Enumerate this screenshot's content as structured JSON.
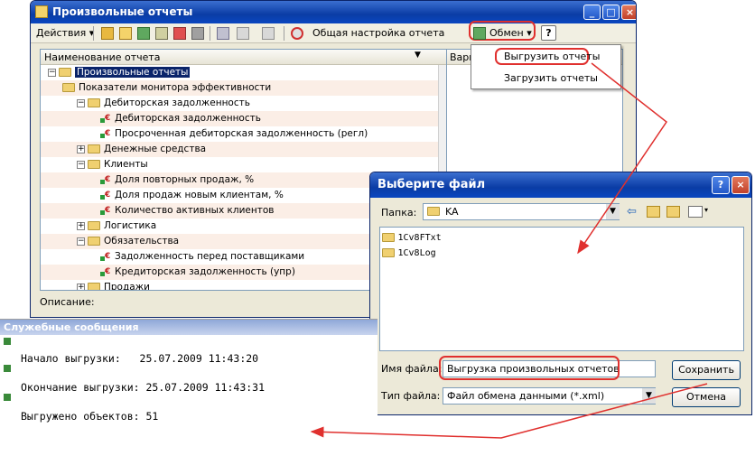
{
  "main_window": {
    "title": "Произвольные отчеты",
    "toolbar": {
      "actions": "Действия",
      "general_settings": "Общая настройка отчета",
      "exchange": "Обмен",
      "help": "?"
    },
    "tree": {
      "header": "Наименование отчета",
      "right_header": "Вари",
      "items": [
        {
          "label": "Произвольные отчеты",
          "type": "folder",
          "level": 0,
          "expanded": true
        },
        {
          "label": "Показатели монитора эффективности",
          "type": "folder",
          "level": 1
        },
        {
          "label": "Дебиторская задолженность",
          "type": "folder",
          "level": 2,
          "expanded": true
        },
        {
          "label": "Дебиторская задолженность",
          "type": "report",
          "level": 3
        },
        {
          "label": "Просроченная дебиторская задолженность (регл)",
          "type": "report",
          "level": 3
        },
        {
          "label": "Денежные средства",
          "type": "folder",
          "level": 2,
          "expanded": false
        },
        {
          "label": "Клиенты",
          "type": "folder",
          "level": 2,
          "expanded": true
        },
        {
          "label": "Доля повторных продаж, %",
          "type": "report",
          "level": 3
        },
        {
          "label": "Доля продаж новым клиентам, %",
          "type": "report",
          "level": 3
        },
        {
          "label": "Количество активных клиентов",
          "type": "report",
          "level": 3
        },
        {
          "label": "Логистика",
          "type": "folder",
          "level": 2,
          "expanded": false
        },
        {
          "label": "Обязательства",
          "type": "folder",
          "level": 2,
          "expanded": true
        },
        {
          "label": "Задолженность перед поставщиками",
          "type": "report",
          "level": 3
        },
        {
          "label": "Кредиторская задолженность (упр)",
          "type": "report",
          "level": 3
        },
        {
          "label": "Продажи",
          "type": "folder",
          "level": 2,
          "expanded": false
        }
      ]
    },
    "description_label": "Описание:"
  },
  "exchange_menu": {
    "items": [
      "Выгрузить отчеты",
      "Загрузить отчеты"
    ]
  },
  "file_dialog": {
    "title": "Выберите файл",
    "folder_label": "Папка:",
    "folder_value": "KA",
    "files": [
      "1Cv8FTxt",
      "1Cv8Log"
    ],
    "filename_label": "Имя файла:",
    "filename_value": "Выгрузка произвольных отчетов",
    "filetype_label": "Тип файла:",
    "filetype_value": "Файл обмена данными (*.xml)",
    "save_button": "Сохранить",
    "cancel_button": "Отмена"
  },
  "messages": {
    "title": "Служебные сообщения",
    "lines": [
      "Начало выгрузки:   25.07.2009 11:43:20",
      "Окончание выгрузки: 25.07.2009 11:43:31",
      "Выгружено объектов: 51"
    ]
  },
  "colors": {
    "accent_red": "#e0302e",
    "title_blue": "#0a3ca5",
    "row_alt": "#fbeee6"
  }
}
